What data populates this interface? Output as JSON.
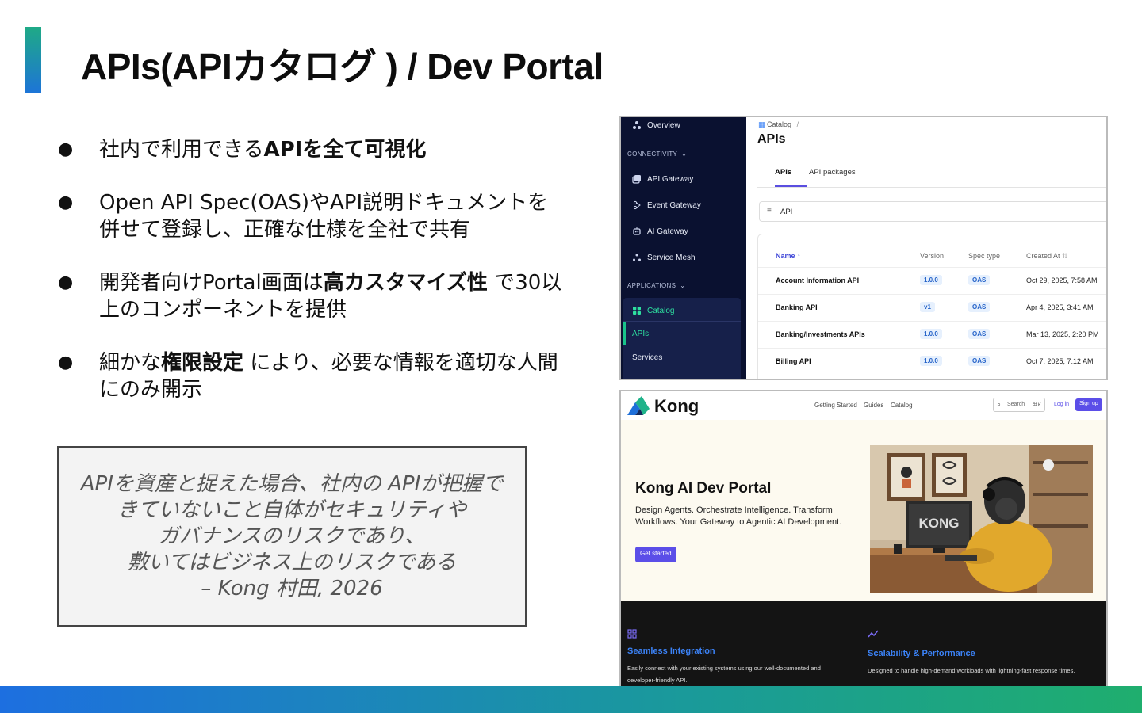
{
  "slide": {
    "title": "APIs(APIカタログ ) / Dev Portal"
  },
  "bullets": [
    {
      "symbol": "●",
      "parts": [
        {
          "t": "社内で利用できる",
          "b": false
        },
        {
          "t": "APIを全て可視化",
          "b": true
        }
      ]
    },
    {
      "symbol": "●",
      "parts": [
        {
          "t": "Open API Spec(OAS)やAPI説明ドキュメントを併せて登録し、正確な仕様を全社で共有",
          "b": false
        }
      ]
    },
    {
      "symbol": "●",
      "parts": [
        {
          "t": "開発者向けPortal画面は",
          "b": false
        },
        {
          "t": "高カスタマイズ性",
          "b": true
        },
        {
          "t": " で30以上のコンポーネントを提供",
          "b": false
        }
      ]
    },
    {
      "symbol": "●",
      "parts": [
        {
          "t": "細かな",
          "b": false
        },
        {
          "t": "権限設定",
          "b": true
        },
        {
          "t": " により、必要な情報を適切な人間にのみ開示",
          "b": false
        }
      ]
    }
  ],
  "quote": {
    "lines": [
      "APIを資産と捉えた場合、社内の APIが把握で",
      "きていないこと自体がセキュリティや",
      "ガバナンスのリスクであり、",
      "敷いてはビジネス上のリスクである",
      "– Kong 村田, 2026"
    ]
  },
  "catalog_screenshot": {
    "sidebar": {
      "overview": "Overview",
      "connectivity_header": "CONNECTIVITY",
      "connectivity_items": [
        "API Gateway",
        "Event Gateway",
        "AI Gateway",
        "Service Mesh"
      ],
      "applications_header": "APPLICATIONS",
      "catalog": "Catalog",
      "catalog_items": [
        "APIs",
        "Services"
      ]
    },
    "breadcrumb": "Catalog",
    "breadcrumb_sep": "/",
    "page_title": "APIs",
    "tabs": [
      "APIs",
      "API packages"
    ],
    "filter_value": "API",
    "columns": {
      "name": "Name",
      "version": "Version",
      "spec_type": "Spec type",
      "created_at": "Created At"
    },
    "rows": [
      {
        "name": "Account Information API",
        "version": "1.0.0",
        "spec": "OAS",
        "created": "Oct 29, 2025, 7:58 AM"
      },
      {
        "name": "Banking API",
        "version": "v1",
        "spec": "OAS",
        "created": "Apr 4, 2025, 3:41 AM"
      },
      {
        "name": "Banking/Investments APIs",
        "version": "1.0.0",
        "spec": "OAS",
        "created": "Mar 13, 2025, 2:20 PM"
      },
      {
        "name": "Billing API",
        "version": "1.0.0",
        "spec": "OAS",
        "created": "Oct 7, 2025, 7:12 AM"
      }
    ]
  },
  "portal_screenshot": {
    "brand": "Kong",
    "nav": [
      "Getting Started",
      "Guides",
      "Catalog"
    ],
    "search_placeholder": "Search",
    "search_shortcut": "⌘K",
    "login": "Log in",
    "signup": "Sign up",
    "hero_title": "Kong AI Dev Portal",
    "hero_desc": "Design Agents. Orchestrate Intelligence. Transform Workflows. Your Gateway to Agentic AI Development.",
    "hero_button": "Get started",
    "hero_image_text": "KONG",
    "features": [
      {
        "icon": "grid-icon",
        "title": "Seamless Integration",
        "desc": "Easily connect with your existing systems using our well-documented and developer-friendly API."
      },
      {
        "icon": "trend-icon",
        "title": "Scalability & Performance",
        "desc": "Designed to handle high-demand workloads with lightning-fast response times."
      }
    ]
  },
  "colors": {
    "accent_gradient_start": "#1faa86",
    "accent_gradient_end": "#1d74d8",
    "sidebar_bg": "#0a1130",
    "portal_primary": "#5b4ee8"
  }
}
